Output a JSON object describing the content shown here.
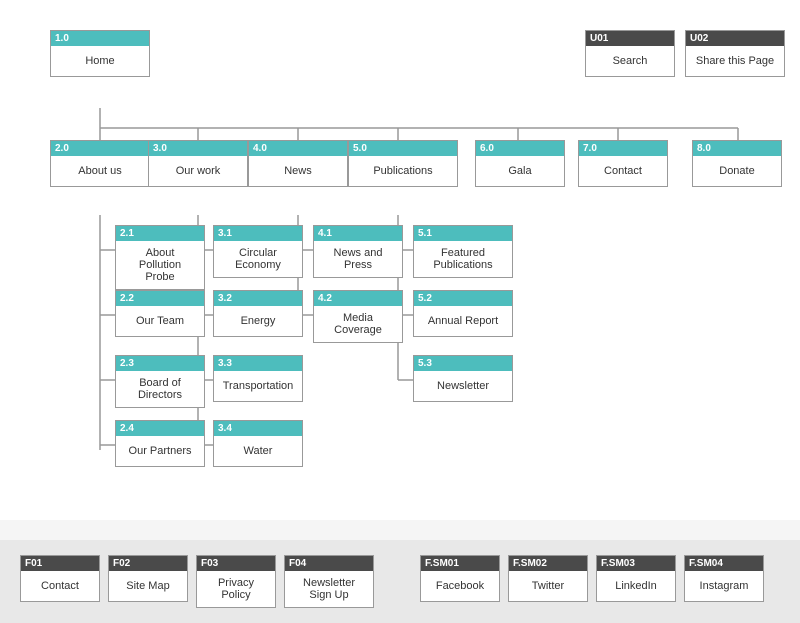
{
  "home": {
    "id": "1.0",
    "label": "Home"
  },
  "utility": [
    {
      "id": "U01",
      "label": "Search"
    },
    {
      "id": "U02",
      "label": "Share this Page"
    }
  ],
  "nav": [
    {
      "id": "2.0",
      "label": "About us",
      "children": [
        {
          "id": "2.1",
          "label": "About Pollution Probe"
        },
        {
          "id": "2.2",
          "label": "Our Team"
        },
        {
          "id": "2.3",
          "label": "Board of Directors"
        },
        {
          "id": "2.4",
          "label": "Our Partners"
        }
      ]
    },
    {
      "id": "3.0",
      "label": "Our work",
      "children": [
        {
          "id": "3.1",
          "label": "Circular Economy"
        },
        {
          "id": "3.2",
          "label": "Energy"
        },
        {
          "id": "3.3",
          "label": "Transportation"
        },
        {
          "id": "3.4",
          "label": "Water"
        }
      ]
    },
    {
      "id": "4.0",
      "label": "News",
      "children": [
        {
          "id": "4.1",
          "label": "News and Press"
        },
        {
          "id": "4.2",
          "label": "Media Coverage"
        }
      ]
    },
    {
      "id": "5.0",
      "label": "Publications",
      "children": [
        {
          "id": "5.1",
          "label": "Featured Publications"
        },
        {
          "id": "5.2",
          "label": "Annual Report"
        },
        {
          "id": "5.3",
          "label": "Newsletter"
        }
      ]
    },
    {
      "id": "6.0",
      "label": "Gala",
      "children": []
    },
    {
      "id": "7.0",
      "label": "Contact",
      "children": []
    },
    {
      "id": "8.0",
      "label": "Donate",
      "children": []
    }
  ],
  "footer": {
    "items_left": [
      {
        "id": "F01",
        "label": "Contact"
      },
      {
        "id": "F02",
        "label": "Site Map"
      },
      {
        "id": "F03",
        "label": "Privacy Policy"
      },
      {
        "id": "F04",
        "label": "Newsletter Sign Up"
      }
    ],
    "items_right": [
      {
        "id": "F.SM01",
        "label": "Facebook"
      },
      {
        "id": "F.SM02",
        "label": "Twitter"
      },
      {
        "id": "F.SM03",
        "label": "LinkedIn"
      },
      {
        "id": "F.SM04",
        "label": "Instagram"
      }
    ]
  }
}
